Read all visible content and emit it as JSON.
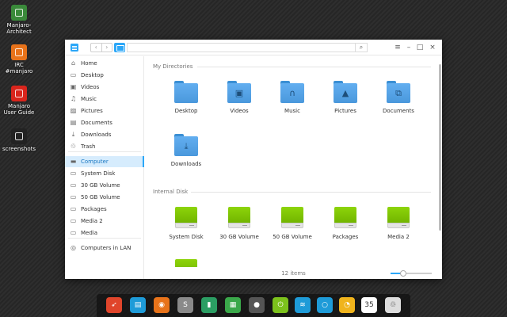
{
  "desktop": {
    "icons": [
      {
        "label": "Manjaro-Architect",
        "icon": "manjaro-architect-icon",
        "color": "#3a8a3a"
      },
      {
        "label": "IRC #manjaro",
        "icon": "irc-hexchat-icon",
        "color": "#e8731a"
      },
      {
        "label": "Manjaro User Guide",
        "icon": "pdf-document-icon",
        "color": "#d9251c"
      },
      {
        "label": "screenshots",
        "icon": "screenshots-folder-icon",
        "color": "#222222"
      }
    ]
  },
  "window": {
    "nav": {
      "back": "‹",
      "forward": "›"
    },
    "search_symbol": "⌕",
    "controls": {
      "menu": "≡",
      "minimize": "–",
      "maximize": "□",
      "close": "×"
    },
    "accent": "#2ca7f8"
  },
  "sidebar": {
    "items": [
      {
        "label": "Home",
        "icon": "home-icon",
        "glyph": "⌂"
      },
      {
        "label": "Desktop",
        "icon": "desktop-icon",
        "glyph": "▭"
      },
      {
        "label": "Videos",
        "icon": "videos-icon",
        "glyph": "▣"
      },
      {
        "label": "Music",
        "icon": "music-icon",
        "glyph": "♫"
      },
      {
        "label": "Pictures",
        "icon": "pictures-icon",
        "glyph": "▨"
      },
      {
        "label": "Documents",
        "icon": "documents-icon",
        "glyph": "▤"
      },
      {
        "label": "Downloads",
        "icon": "downloads-icon",
        "glyph": "⤓"
      },
      {
        "label": "Trash",
        "icon": "trash-icon",
        "glyph": "♲"
      },
      {
        "label": "Computer",
        "icon": "computer-icon",
        "glyph": "▬"
      },
      {
        "label": "System Disk",
        "icon": "disk-icon",
        "glyph": "▭"
      },
      {
        "label": "30 GB Volume",
        "icon": "disk-icon",
        "glyph": "▭"
      },
      {
        "label": "50 GB Volume",
        "icon": "disk-icon",
        "glyph": "▭"
      },
      {
        "label": "Packages",
        "icon": "disk-icon",
        "glyph": "▭"
      },
      {
        "label": "Media 2",
        "icon": "disk-icon",
        "glyph": "▭"
      },
      {
        "label": "Media",
        "icon": "disk-icon",
        "glyph": "▭"
      },
      {
        "label": "Computers in LAN",
        "icon": "network-icon",
        "glyph": "◎"
      }
    ],
    "active": "Computer"
  },
  "main": {
    "my_directories": {
      "title": "My Directories",
      "items": [
        {
          "label": "Desktop",
          "icon": "desktop-folder-icon",
          "glyph": ""
        },
        {
          "label": "Videos",
          "icon": "videos-folder-icon",
          "glyph": "▣"
        },
        {
          "label": "Music",
          "icon": "music-folder-icon",
          "glyph": "∩"
        },
        {
          "label": "Pictures",
          "icon": "pictures-folder-icon",
          "glyph": "▲"
        },
        {
          "label": "Documents",
          "icon": "documents-folder-icon",
          "glyph": "⧉"
        },
        {
          "label": "Downloads",
          "icon": "downloads-folder-icon",
          "glyph": "⤓"
        }
      ]
    },
    "internal_disk": {
      "title": "Internal Disk",
      "items": [
        {
          "label": "System Disk"
        },
        {
          "label": "30 GB Volume"
        },
        {
          "label": "50 GB Volume"
        },
        {
          "label": "Packages"
        },
        {
          "label": "Media 2"
        },
        {
          "label": ""
        }
      ]
    }
  },
  "status": {
    "item_count": "12 items",
    "zoom_level": 0.3
  },
  "dock": {
    "items": [
      {
        "icon": "launcher-rocket-icon",
        "color": "#e0452b",
        "glyph": "➶"
      },
      {
        "icon": "file-manager-icon",
        "color": "#1e9bd8",
        "glyph": "▤"
      },
      {
        "icon": "firefox-icon",
        "color": "#e8731a",
        "glyph": "◉"
      },
      {
        "icon": "settings-icon",
        "color": "#8a8a8a",
        "glyph": "S"
      },
      {
        "icon": "terminal-icon",
        "color": "#2b9e63",
        "glyph": "▮"
      },
      {
        "icon": "package-manager-icon",
        "color": "#3aa84a",
        "glyph": "▦"
      },
      {
        "icon": "toggle-icon",
        "color": "#555555",
        "glyph": "●"
      },
      {
        "icon": "power-icon",
        "color": "#7cc21c",
        "glyph": "⏻"
      },
      {
        "icon": "wifi-icon",
        "color": "#1e9bd8",
        "glyph": "≋"
      },
      {
        "icon": "notification-ring-icon",
        "color": "#1e9bd8",
        "glyph": "○"
      },
      {
        "icon": "clock-icon",
        "color": "#f0b41c",
        "glyph": "◔"
      },
      {
        "icon": "calendar-icon",
        "color": "#ffffff",
        "glyph": "35"
      },
      {
        "icon": "trash-dock-icon",
        "color": "#dddddd",
        "glyph": "♲"
      }
    ]
  }
}
